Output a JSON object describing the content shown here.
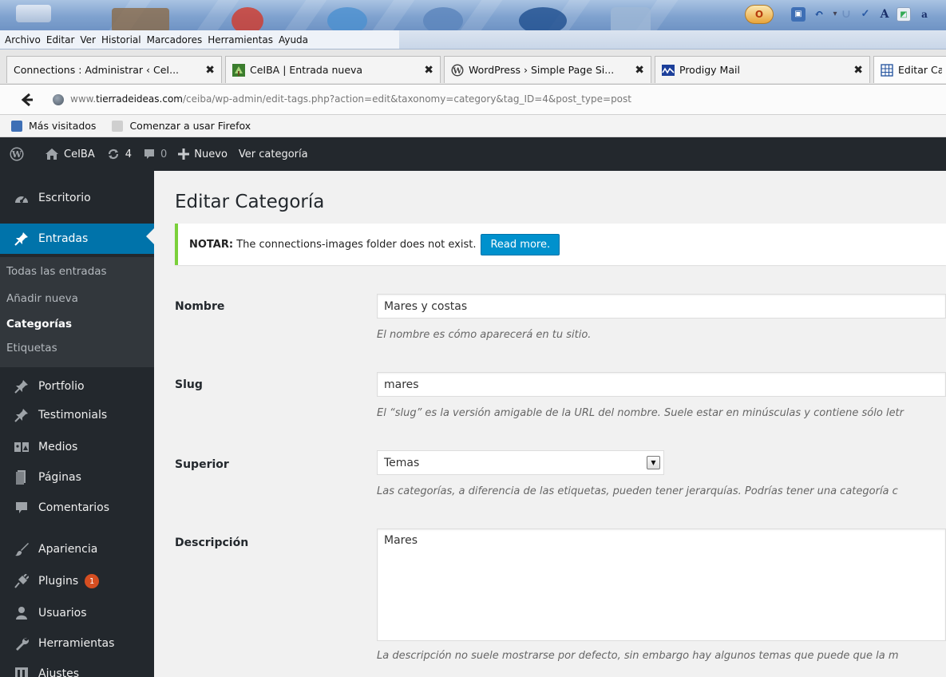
{
  "browser": {
    "menu": [
      "Archivo",
      "Editar",
      "Ver",
      "Historial",
      "Marcadores",
      "Herramientas",
      "Ayuda"
    ],
    "tabs": [
      {
        "label": "Connections : Administrar ‹ CeI...",
        "close": "✖"
      },
      {
        "label": "CeIBA | Entrada nueva",
        "close": "✖"
      },
      {
        "label": "WordPress › Simple Page Si...",
        "close": "✖"
      },
      {
        "label": "Prodigy Mail",
        "close": "✖"
      },
      {
        "label": "Editar Ca"
      }
    ],
    "url": {
      "prefix": "www.",
      "domain": "tierradeideas.com",
      "path": "/ceiba/wp-admin/edit-tags.php?action=edit&taxonomy=category&tag_ID=4&post_type=post"
    },
    "bookmarks": [
      "Más visitados",
      "Comenzar a usar Firefox"
    ]
  },
  "adminbar": {
    "site": "CeIBA",
    "updates": "4",
    "comments": "0",
    "new": "Nuevo",
    "view": "Ver categoría"
  },
  "sidebar": {
    "items": [
      {
        "label": "Escritorio",
        "icon": "dashboard-icon"
      },
      {
        "label": "Entradas",
        "icon": "pin-icon"
      },
      {
        "label": "Portfolio",
        "icon": "pin-icon"
      },
      {
        "label": "Testimonials",
        "icon": "pin-icon"
      },
      {
        "label": "Medios",
        "icon": "media-icon"
      },
      {
        "label": "Páginas",
        "icon": "pages-icon"
      },
      {
        "label": "Comentarios",
        "icon": "comment-icon"
      },
      {
        "label": "Apariencia",
        "icon": "brush-icon"
      },
      {
        "label": "Plugins",
        "icon": "plug-icon",
        "badge": "1"
      },
      {
        "label": "Usuarios",
        "icon": "users-icon"
      },
      {
        "label": "Herramientas",
        "icon": "wrench-icon"
      },
      {
        "label": "Ajustes",
        "icon": "settings-icon"
      }
    ],
    "submenu": [
      "Todas las entradas",
      "Añadir nueva",
      "Categorías",
      "Etiquetas"
    ],
    "colors": {
      "background": "#23282d",
      "current": "#0073aa",
      "submenu_bg": "#32373c"
    }
  },
  "content": {
    "title": "Editar Categoría",
    "notice": {
      "strong": "NOTAR:",
      "text": "The connections-images folder does not exist.",
      "button": "Read more."
    },
    "fields": {
      "name": {
        "label": "Nombre",
        "value": "Mares y costas",
        "help": "El nombre es cómo aparecerá en tu sitio."
      },
      "slug": {
        "label": "Slug",
        "value": "mares",
        "help": "El “slug” es la versión amigable de la URL del nombre. Suele estar en minúsculas y contiene sólo letr"
      },
      "parent": {
        "label": "Superior",
        "value": "Temas",
        "help": "Las categorías, a diferencia de las etiquetas, pueden tener jerarquías. Podrías tener una categoría c"
      },
      "description": {
        "label": "Descripción",
        "value": "Mares",
        "help": "La descripción no suele mostrarse por defecto, sin embargo hay algunos temas que puede que la m"
      }
    }
  }
}
